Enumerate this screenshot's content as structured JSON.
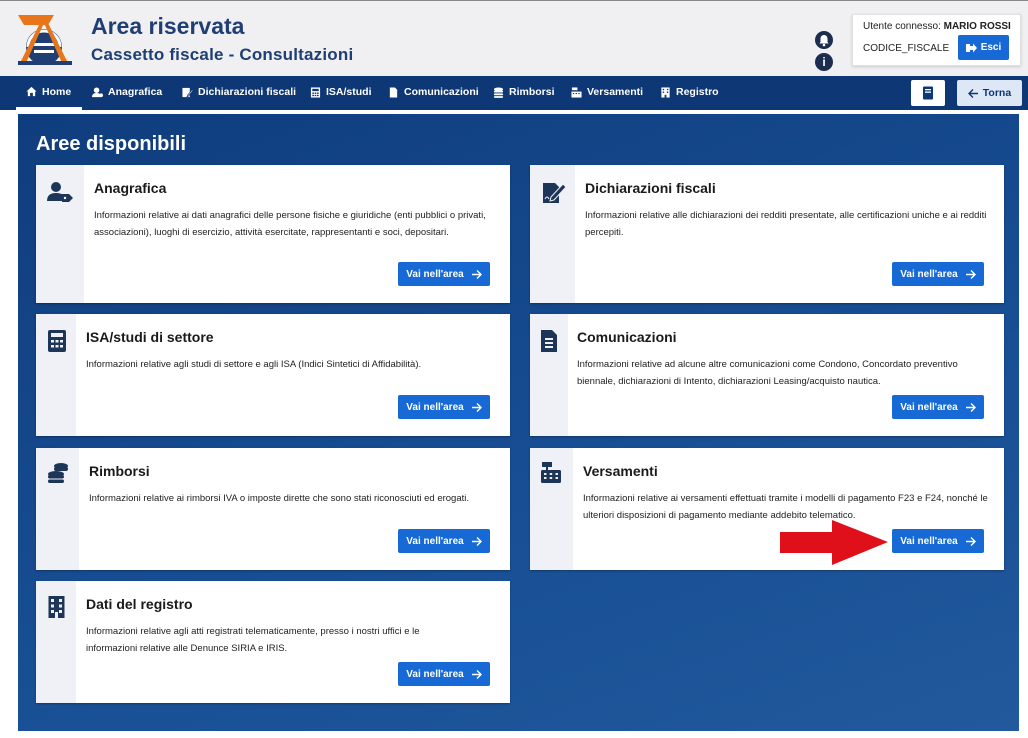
{
  "header": {
    "title": "Area riservata",
    "subtitle": "Cassetto fiscale - Consultazioni",
    "user_label": "Utente connesso:",
    "user_name": "MARIO ROSSI",
    "codice_fiscale": "CODICE_FISCALE",
    "logout_label": "Esci",
    "bell_icon": "bell-icon",
    "info_icon": "info-icon"
  },
  "nav": {
    "items": [
      {
        "label": "Home",
        "icon": "home-icon"
      },
      {
        "label": "Anagrafica",
        "icon": "user-icon"
      },
      {
        "label": "Dichiarazioni fiscali",
        "icon": "edit-icon"
      },
      {
        "label": "ISA/studi",
        "icon": "calculator-icon"
      },
      {
        "label": "Comunicazioni",
        "icon": "document-icon"
      },
      {
        "label": "Rimborsi",
        "icon": "coins-icon"
      },
      {
        "label": "Versamenti",
        "icon": "cash-register-icon"
      },
      {
        "label": "Registro",
        "icon": "building-icon"
      }
    ],
    "back_label": "Torna",
    "book_icon": "book-icon"
  },
  "main": {
    "title": "Aree disponibili",
    "button_label": "Vai nell'area",
    "cards": [
      {
        "title": "Anagrafica",
        "text": "Informazioni relative ai dati anagrafici delle persone fisiche e giuridiche (enti pubblici o privati, associazioni), luoghi di esercizio, attività esercitate, rappresentanti e soci, depositari.",
        "icon": "user-tag-icon"
      },
      {
        "title": "Dichiarazioni fiscali",
        "text": "Informazioni relative alle dichiarazioni dei redditi presentate, alle certificazioni uniche e ai redditi percepiti.",
        "icon": "signature-icon"
      },
      {
        "title": "ISA/studi di settore",
        "text": "Informazioni relative agli studi di settore e agli ISA (Indici Sintetici di Affidabilità).",
        "icon": "calculator-icon"
      },
      {
        "title": "Comunicazioni",
        "text": "Informazioni relative ad alcune altre comunicazioni come Condono, Concordato preventivo biennale, dichiarazioni di Intento, dichiarazioni Leasing/acquisto nautica.",
        "icon": "document-icon"
      },
      {
        "title": "Rimborsi",
        "text": "Informazioni relative ai rimborsi IVA o imposte dirette che sono stati riconosciuti ed erogati.",
        "icon": "coins-icon"
      },
      {
        "title": "Versamenti",
        "text": "Informazioni relative ai versamenti effettuati tramite i modelli di pagamento F23 e F24, nonché le ulteriori disposizioni di pagamento mediante addebito telematico.",
        "icon": "cash-register-icon"
      },
      {
        "title": "Dati del registro",
        "text": "Informazioni relative agli atti registrati telematicamente, presso i nostri uffici e le informazioni relative alle Denunce SIRIA e IRIS.",
        "icon": "building-icon"
      }
    ]
  },
  "colors": {
    "brand_dark": "#0d3775",
    "button_blue": "#1769d6",
    "title_blue": "#1f3e73",
    "annotation_red": "#e0101a"
  }
}
